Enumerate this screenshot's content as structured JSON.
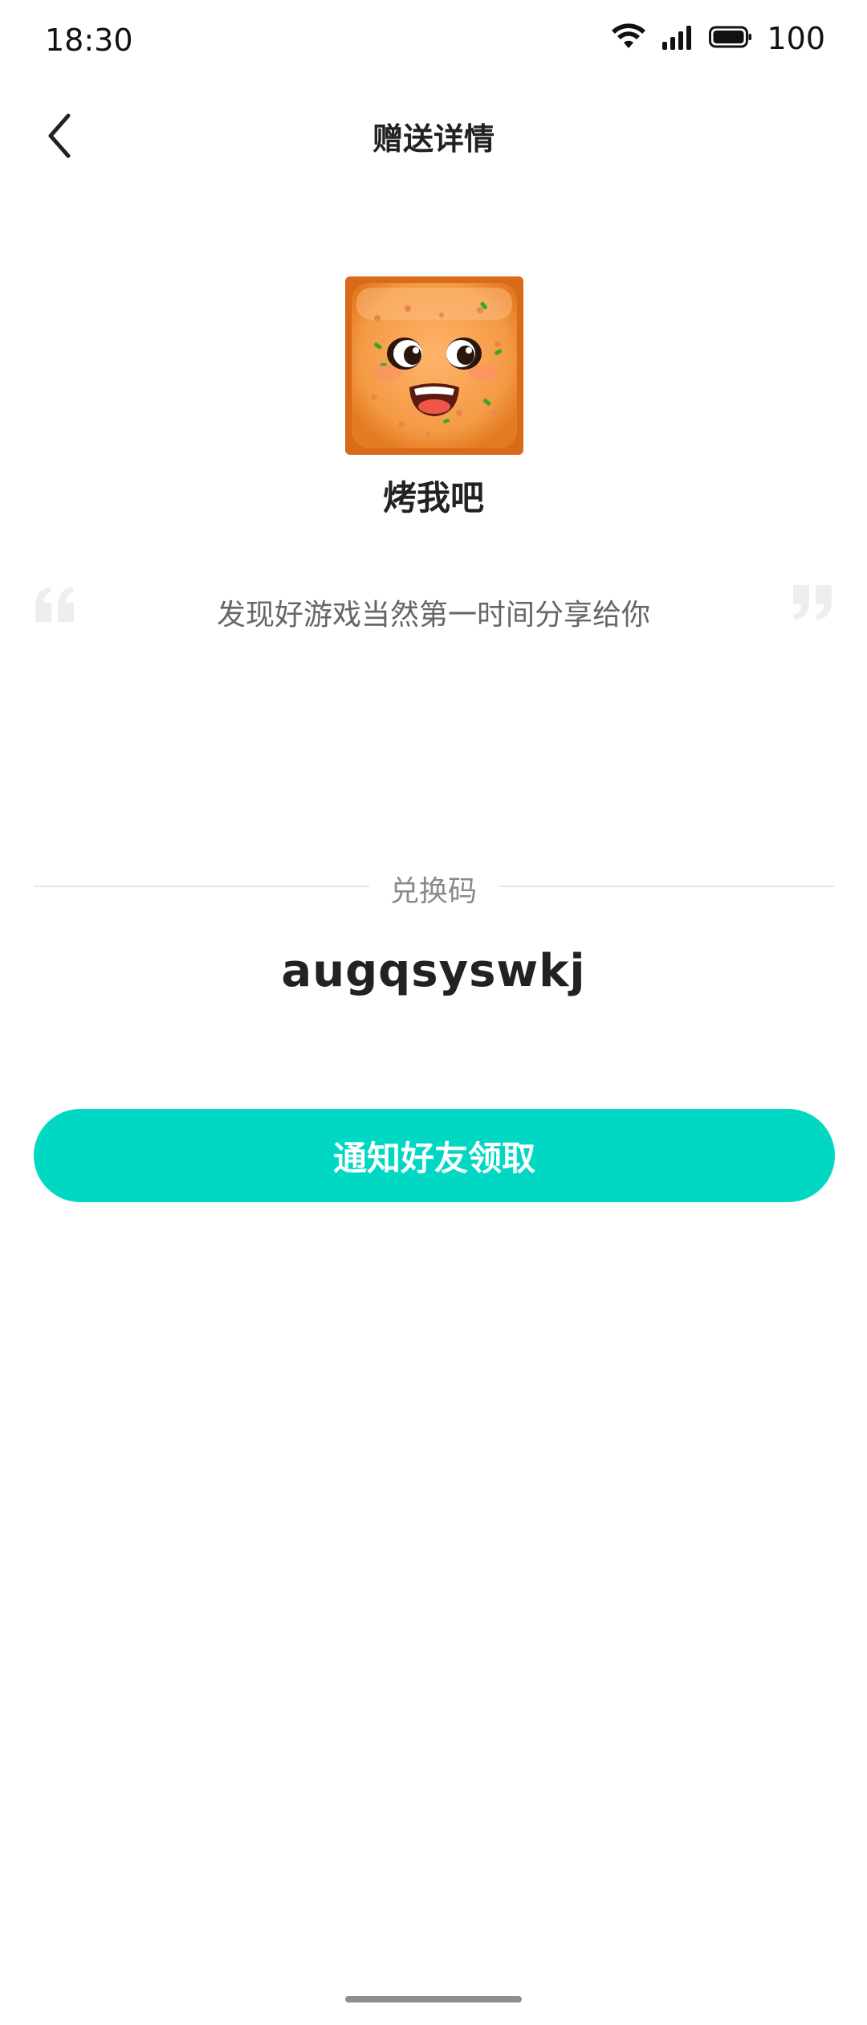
{
  "status_bar": {
    "time": "18:30",
    "battery": "100",
    "icons": [
      "wifi-icon",
      "signal-icon",
      "battery-icon"
    ]
  },
  "header": {
    "title": "赠送详情",
    "back_icon": "chevron-left-icon"
  },
  "game": {
    "name": "烤我吧",
    "icon": "cracker-face-icon"
  },
  "message": {
    "text": "发现好游戏当然第一时间分享给你"
  },
  "redeem": {
    "label": "兑换码",
    "code": "augqsyswkj"
  },
  "actions": {
    "notify_label": "通知好友领取"
  },
  "colors": {
    "accent": "#00d8c4",
    "title": "#222222",
    "secondary": "#666666",
    "quote": "#eeeeee"
  }
}
